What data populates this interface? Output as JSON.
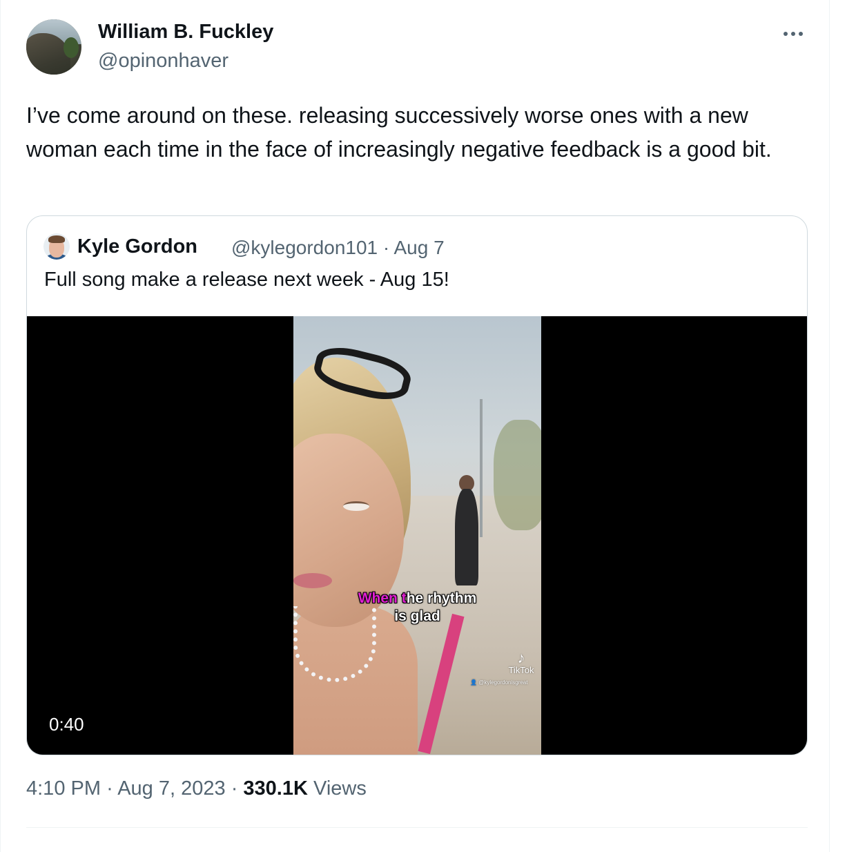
{
  "tweet": {
    "author_name": "William B. Fuckley",
    "author_handle": "@opinonhaver",
    "more_icon": "more-horizontal-icon",
    "text": "I’ve come around on these. releasing successively worse ones with a new woman each time in the face of increasingly negative feedback is a good bit.",
    "time": "4:10 PM",
    "separator": "·",
    "date": "Aug 7, 2023",
    "views_count": "330.1K",
    "views_label": "Views"
  },
  "quote": {
    "author_name": "Kyle Gordon",
    "author_handle": "@kylegordon101",
    "separator": "·",
    "date": "Aug 7",
    "text": "Full song make a release next week - Aug 15!",
    "video": {
      "duration": "0:40",
      "caption_highlight_1": "When",
      "caption_highlight_2": "t",
      "caption_rest_line1": "he rhythm",
      "caption_line2": "is glad",
      "watermark_brand": "TikTok",
      "watermark_handle": "@kylegordonisgreat"
    }
  },
  "colors": {
    "text_primary": "#0f1419",
    "text_secondary": "#536471",
    "border": "#cfd9de",
    "caption_highlight": "#e01fd2"
  }
}
